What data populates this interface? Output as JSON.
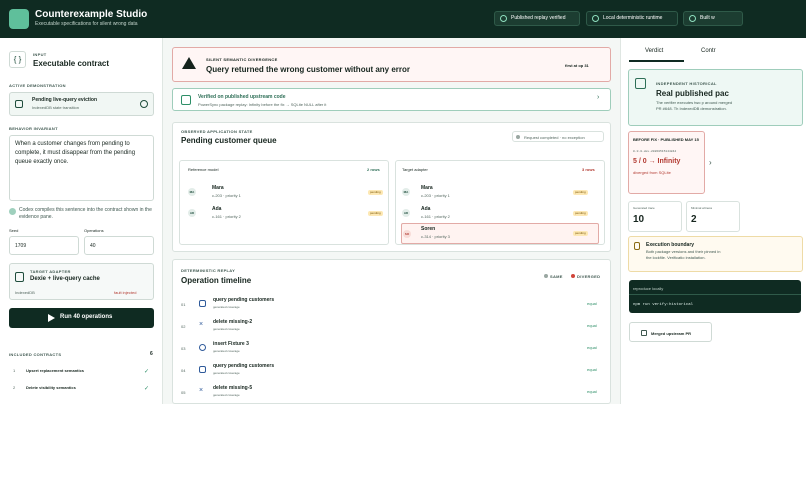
{
  "header": {
    "title": "Counterexample Studio",
    "subtitle": "Executable specifications for silent wrong data",
    "buttons": [
      "Published replay verified",
      "Local deterministic runtime",
      "Built w"
    ]
  },
  "sidebar": {
    "input_label": "INPUT",
    "contract_title": "Executable contract",
    "active_demo_label": "ACTIVE DEMONSTRATION",
    "demo_title": "Pending live-query eviction",
    "demo_sub": "IndexedDB state transition",
    "behavior_label": "BEHAVIOR INVARIANT",
    "invariant_text": "When a customer changes from pending to complete, it must disappear from the pending queue exactly once.",
    "codex_note": "Codex compiles this sentence into the contract shown in the evidence pane.",
    "seed_label": "Seed",
    "seed_value": "1709",
    "ops_label": "Operations",
    "ops_value": "40",
    "target_label": "TARGET ADAPTER",
    "target_title": "Dexie + live-query cache",
    "target_db": "IndexedDB",
    "fault": "fault injected",
    "run_button": "Run 40 operations",
    "included_label": "INCLUDED CONTRACTS",
    "included_count": "6",
    "contracts": [
      {
        "num": "1",
        "label": "Upsert replacement semantics"
      },
      {
        "num": "2",
        "label": "Delete visibility semantics"
      }
    ]
  },
  "alert": {
    "eyebrow": "SILENT SEMANTIC DIVERGENCE",
    "headline": "Query returned the wrong customer without any error",
    "first_at": "first at op 31"
  },
  "verified": {
    "title": "Verified on published upstream code",
    "sub": "PowerSync package replay: Infinity before the fix → SQLite NULL after it"
  },
  "observed": {
    "eyebrow": "OBSERVED APPLICATION STATE",
    "title": "Pending customer queue",
    "status": "Request completed · no exception",
    "reference": {
      "label": "Reference model",
      "count": "2 rows",
      "rows": [
        {
          "badge": "MA",
          "name": "Mara",
          "meta": "c-203 · priority 1",
          "pill": "pending"
        },
        {
          "badge": "AD",
          "name": "Ada",
          "meta": "c-161 · priority 2",
          "pill": "pending"
        }
      ]
    },
    "target": {
      "label": "Target adapter",
      "count": "3 rows",
      "rows": [
        {
          "badge": "MA",
          "name": "Mara",
          "meta": "c-203 · priority 1",
          "pill": "pending"
        },
        {
          "badge": "AD",
          "name": "Ada",
          "meta": "c-161 · priority 2",
          "pill": "pending"
        },
        {
          "badge": "SO",
          "name": "Soren",
          "meta": "c-314 · priority 3",
          "pill": "pending"
        }
      ]
    }
  },
  "timeline": {
    "eyebrow": "DETERMINISTIC REPLAY",
    "title": "Operation timeline",
    "legend_same": "SAME",
    "legend_diverged": "DIVERGED",
    "ops": [
      {
        "num": "01",
        "label": "query pending customers",
        "sub": "generated coverage",
        "status": "equal"
      },
      {
        "num": "02",
        "label": "delete missing-2",
        "sub": "generated coverage",
        "status": "equal"
      },
      {
        "num": "03",
        "label": "insert Fixture 3",
        "sub": "generated coverage",
        "status": "equal"
      },
      {
        "num": "04",
        "label": "query pending customers",
        "sub": "generated coverage",
        "status": "equal"
      },
      {
        "num": "05",
        "label": "delete missing-5",
        "sub": "generated coverage",
        "status": "equal"
      }
    ]
  },
  "right": {
    "tabs": [
      "Verdict",
      "Contr"
    ],
    "historical": {
      "eyebrow": "INDEPENDENT HISTORICAL",
      "title": "Real published pac",
      "body": "The verifier executes two p around merged PR #648. Th IndexedDB demonstration."
    },
    "before": {
      "eyebrow": "BEFORE FIX · PUBLISHED MAY 15",
      "version": "0.0.0-dev-20260515144844",
      "formula": "5 / 0 → Infinity",
      "sub": "diverged from SQLite"
    },
    "stats": [
      {
        "label": "Generated trace",
        "value": "10"
      },
      {
        "label": "Minimal witness",
        "value": "2"
      }
    ],
    "boundary": {
      "title": "Execution boundary",
      "body": "Both package versions and their pinned in the lockfile. Verificatio installation."
    },
    "terminal": {
      "label": "reproduce locally",
      "command": "npm run verify:historical"
    },
    "merged_button": "Merged upstream PR"
  }
}
